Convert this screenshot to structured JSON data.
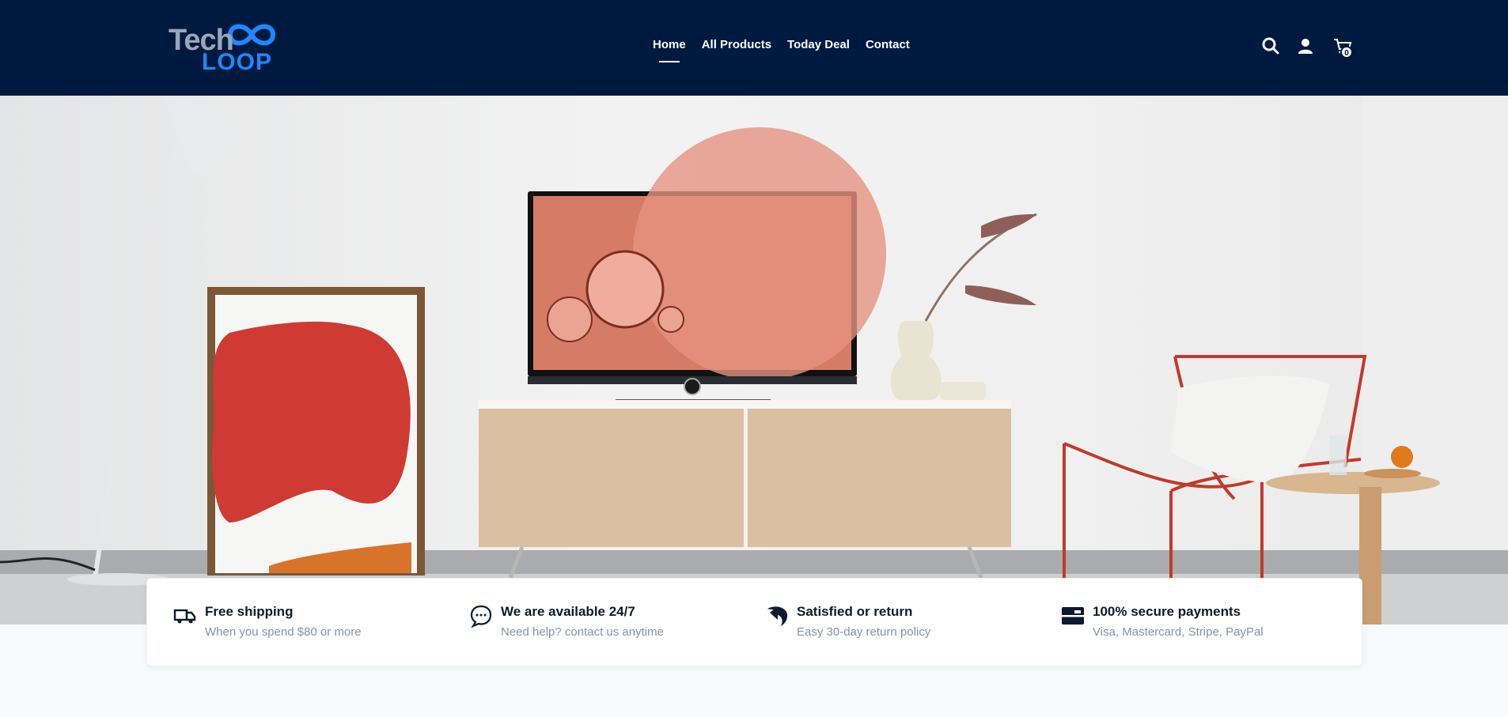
{
  "brand": {
    "logo_top": "Tech",
    "logo_bottom": "LOOP"
  },
  "nav": {
    "items": [
      {
        "label": "Home",
        "active": true
      },
      {
        "label": "All Products",
        "active": false
      },
      {
        "label": "Today Deal",
        "active": false
      },
      {
        "label": "Contact",
        "active": false
      }
    ]
  },
  "header_icons": {
    "search": "search-icon",
    "account": "user-icon",
    "cart": "cart-icon",
    "cart_count": "0"
  },
  "colors": {
    "header_bg": "#001a3f",
    "accent": "#1e88ff",
    "page_bg": "#f7fafb"
  },
  "features": [
    {
      "icon": "truck-icon",
      "title": "Free shipping",
      "desc": "When you spend $80 or more"
    },
    {
      "icon": "chat-icon",
      "title": "We are available 24/7",
      "desc": "Need help? contact us anytime"
    },
    {
      "icon": "return-icon",
      "title": "Satisfied or return",
      "desc": "Easy 30-day return policy"
    },
    {
      "icon": "card-icon",
      "title": "100% secure payments",
      "desc": "Visa, Mastercard, Stripe, PayPal"
    }
  ]
}
